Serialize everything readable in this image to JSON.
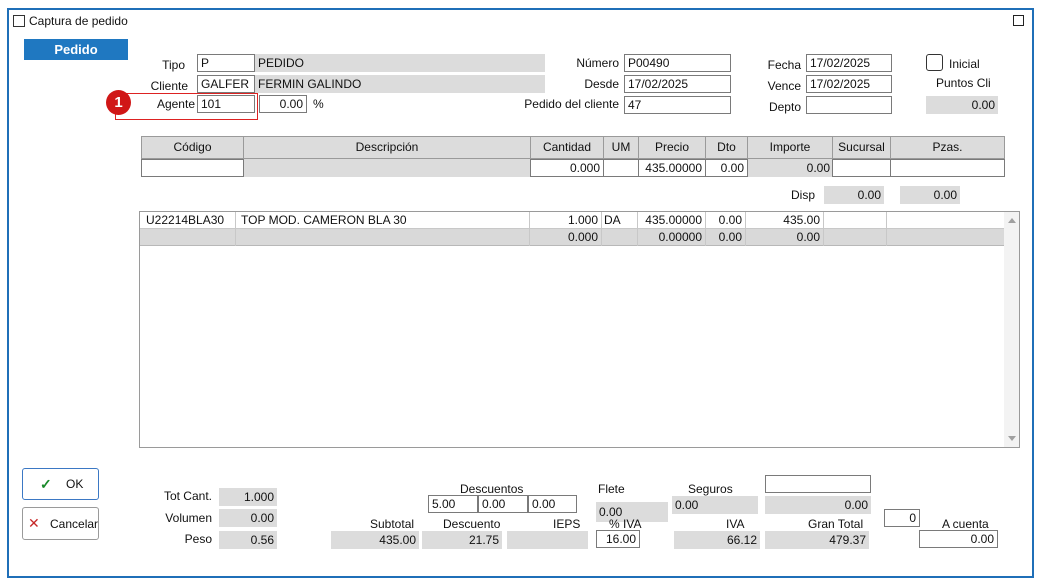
{
  "window": {
    "title": "Captura de pedido"
  },
  "tab": {
    "label": "Pedido"
  },
  "header": {
    "tipo_label": "Tipo",
    "tipo_code": "P",
    "tipo_desc": "PEDIDO",
    "cliente_label": "Cliente",
    "cliente_code": "GALFER",
    "cliente_name": "FERMIN GALINDO",
    "agente_label": "Agente",
    "agente_value": "101",
    "agente_pct": "0.00",
    "pct_symbol": "%",
    "numero_label": "Número",
    "numero_value": "P00490",
    "desde_label": "Desde",
    "desde_value": "17/02/2025",
    "pedido_cliente_label": "Pedido del cliente",
    "pedido_cliente_value": "47",
    "fecha_label": "Fecha",
    "fecha_value": "17/02/2025",
    "vence_label": "Vence",
    "vence_value": "17/02/2025",
    "depto_label": "Depto",
    "depto_value": "",
    "inicial_label": "Inicial",
    "puntos_label": "Puntos Cli",
    "puntos_value": "0.00"
  },
  "badge": {
    "number": "1"
  },
  "grid": {
    "headers": [
      "Código",
      "Descripción",
      "Cantidad",
      "UM",
      "Precio",
      "Dto",
      "Importe",
      "Sucursal",
      "Pzas."
    ],
    "entry": {
      "codigo": "",
      "descripcion": "",
      "cantidad": "0.000",
      "um": "",
      "precio": "435.00000",
      "dto": "0.00",
      "importe": "0.00",
      "sucursal": "",
      "pzas": ""
    },
    "disp_label": "Disp",
    "disp_value1": "0.00",
    "disp_value2": "0.00"
  },
  "items": [
    {
      "codigo": "U22214BLA30",
      "descripcion": "TOP MOD. CAMERON BLA 30",
      "cantidad": "1.000",
      "um": "DA",
      "precio": "435.00000",
      "dto": "0.00",
      "importe": "435.00"
    },
    {
      "codigo": "",
      "descripcion": "",
      "cantidad": "0.000",
      "um": "",
      "precio": "0.00000",
      "dto": "0.00",
      "importe": "0.00"
    }
  ],
  "buttons": {
    "ok": "OK",
    "cancel": "Cancelar"
  },
  "totals": {
    "tot_cant_label": "Tot Cant.",
    "tot_cant": "1.000",
    "volumen_label": "Volumen",
    "volumen": "0.00",
    "peso_label": "Peso",
    "peso": "0.56",
    "descuentos_label": "Descuentos",
    "desc1": "5.00",
    "desc2": "0.00",
    "desc3": "0.00",
    "flete_label": "Flete",
    "flete": "0.00",
    "seguros_label": "Seguros",
    "seguros": "0.00",
    "extra_blank": "",
    "extra_value": "0.00",
    "subtotal_label": "Subtotal",
    "subtotal": "435.00",
    "descuento_label": "Descuento",
    "descuento": "21.75",
    "ieps_label": "IEPS",
    "ieps": "",
    "pct_iva_label": "% IVA",
    "pct_iva": "16.00",
    "iva_label": "IVA",
    "iva": "66.12",
    "gran_total_label": "Gran Total",
    "gran_total": "479.37",
    "a_cuenta_small": "0",
    "a_cuenta_label": "A cuenta",
    "a_cuenta": "0.00"
  }
}
